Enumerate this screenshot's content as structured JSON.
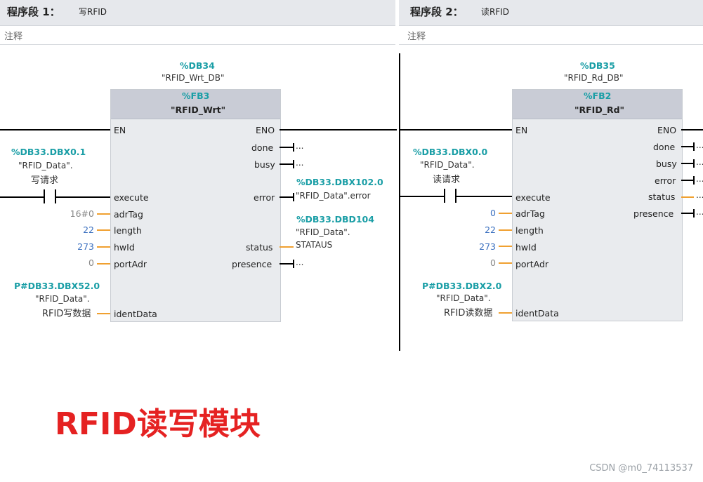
{
  "network1": {
    "segment_label": "程序段 1：",
    "segment_title": "写RFID",
    "comment_placeholder": "注释",
    "instance_db_address": "%DB34",
    "instance_db_name": "\"RFID_Wrt_DB\"",
    "fb_address": "%FB3",
    "fb_name": "\"RFID_Wrt\"",
    "pins_left": [
      "EN",
      "execute",
      "adrTag",
      "length",
      "hwId",
      "portAdr",
      "identData"
    ],
    "pins_right": [
      "ENO",
      "done",
      "busy",
      "error",
      "status",
      "presence"
    ],
    "inputs": {
      "execute_address": "%DB33.DBX0.1",
      "execute_symbol_1": "\"RFID_Data\".",
      "execute_symbol_2": "写请求",
      "adrTag": "16#0",
      "length": "22",
      "hwId": "273",
      "portAdr": "0",
      "identData_address": "P#DB33.DBX52.0",
      "identData_symbol_1": "\"RFID_Data\".",
      "identData_symbol_2": "RFID写数据"
    },
    "outputs": {
      "done": "...",
      "busy": "...",
      "error_address": "%DB33.DBX102.0",
      "error_symbol": "\"RFID_Data\".error",
      "status_address": "%DB33.DBD104",
      "status_symbol_1": "\"RFID_Data\".",
      "status_symbol_2": "STATAUS",
      "presence": "..."
    }
  },
  "network2": {
    "segment_label": "程序段 2：",
    "segment_title": "读RFID",
    "comment_placeholder": "注释",
    "instance_db_address": "%DB35",
    "instance_db_name": "\"RFID_Rd_DB\"",
    "fb_address": "%FB2",
    "fb_name": "\"RFID_Rd\"",
    "pins_left": [
      "EN",
      "execute",
      "adrTag",
      "length",
      "hwId",
      "portAdr",
      "identData"
    ],
    "pins_right": [
      "ENO",
      "done",
      "busy",
      "error",
      "status",
      "presence"
    ],
    "inputs": {
      "execute_address": "%DB33.DBX0.0",
      "execute_symbol_1": "\"RFID_Data\".",
      "execute_symbol_2": "读请求",
      "adrTag": "0",
      "length": "22",
      "hwId": "273",
      "portAdr": "0",
      "identData_address": "P#DB33.DBX2.0",
      "identData_symbol_1": "\"RFID_Data\".",
      "identData_symbol_2": "RFID读数据"
    },
    "outputs": {
      "done": "...",
      "busy": "...",
      "error": "...",
      "status": "...",
      "presence": "..."
    }
  },
  "caption": "RFID读写模块",
  "watermark": "CSDN @m0_74113537",
  "colors": {
    "address_teal": "#1a9ea6",
    "constant_blue": "#3a6fbf",
    "wire_orange": "#f0a030",
    "caption_red": "#e52222"
  }
}
